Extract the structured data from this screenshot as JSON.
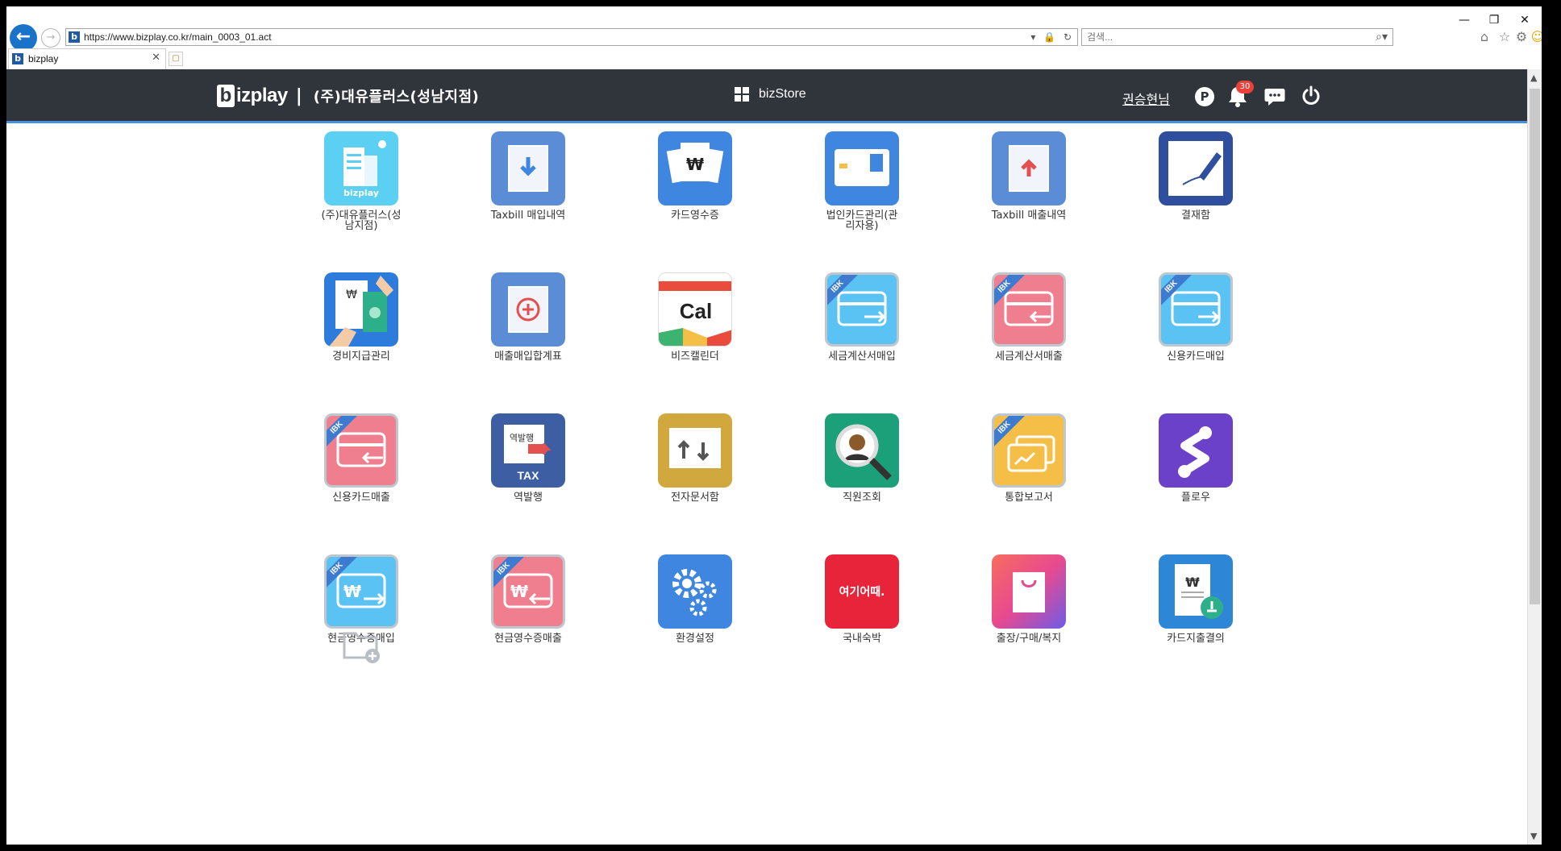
{
  "browser": {
    "url": "https://www.bizplay.co.kr/main_0003_01.act",
    "search_placeholder": "검색...",
    "tab_title": "bizplay",
    "favicon_letter": "b"
  },
  "header": {
    "logo_text": "bizplay",
    "logo_divider": "|",
    "company": "(주)대유플러스(성남지점)",
    "bizstore_label": "bizStore",
    "user_name": "권승현님",
    "point_label": "P",
    "notification_count": "30"
  },
  "apps": [
    {
      "label": "(주)대유플러스(성남지점)",
      "icon": "building-icon",
      "color": "#5bd0f2"
    },
    {
      "label": "Taxbill 매입내역",
      "icon": "taxbill-in-icon",
      "color": "#5b8dd6"
    },
    {
      "label": "카드영수증",
      "icon": "card-receipt-icon",
      "color": "#3f86e0"
    },
    {
      "label": "법인카드관리(관리자용)",
      "icon": "corporate-card-icon",
      "color": "#3f86e0"
    },
    {
      "label": "Taxbill 매출내역",
      "icon": "taxbill-out-icon",
      "color": "#5b8dd6"
    },
    {
      "label": "결재함",
      "icon": "approval-icon",
      "color": "#2f4f9e"
    },
    {
      "label": "경비지급관리",
      "icon": "expense-icon",
      "color": "#2d7cdc"
    },
    {
      "label": "매출매입합계표",
      "icon": "summary-icon",
      "color": "#5b8dd6"
    },
    {
      "label": "비즈캘린더",
      "icon": "calendar-icon",
      "color": "#ffffff"
    },
    {
      "label": "세금계산서매입",
      "icon": "tax-invoice-in-icon",
      "color": "#5ac3f3"
    },
    {
      "label": "세금계산서매출",
      "icon": "tax-invoice-out-icon",
      "color": "#ef7e8e"
    },
    {
      "label": "신용카드매입",
      "icon": "credit-card-in-icon",
      "color": "#5ac3f3"
    },
    {
      "label": "신용카드매출",
      "icon": "credit-card-out-icon",
      "color": "#ef7e8e"
    },
    {
      "label": "역발행",
      "icon": "reverse-issue-icon",
      "color": "#3d5ea3"
    },
    {
      "label": "전자문서함",
      "icon": "edoc-icon",
      "color": "#d1a83d"
    },
    {
      "label": "직원조회",
      "icon": "employee-search-icon",
      "color": "#1ba07a"
    },
    {
      "label": "통합보고서",
      "icon": "report-icon",
      "color": "#f5be46"
    },
    {
      "label": "플로우",
      "icon": "flow-icon",
      "color": "#6a41c8"
    },
    {
      "label": "현금영수증매입",
      "icon": "cash-receipt-in-icon",
      "color": "#5ac3f3"
    },
    {
      "label": "현금영수증매출",
      "icon": "cash-receipt-out-icon",
      "color": "#ef7e8e"
    },
    {
      "label": "환경설정",
      "icon": "settings-icon",
      "color": "#3f86e0"
    },
    {
      "label": "국내숙박",
      "icon": "yeogi-icon",
      "color": "#e8243a"
    },
    {
      "label": "출장/구매/복지",
      "icon": "shopping-bag-icon",
      "color": "#e95a8a"
    },
    {
      "label": "카드지출결의",
      "icon": "card-expense-icon",
      "color": "#2e86d6"
    }
  ],
  "icon_text": {
    "bizplay_small": "bizplay",
    "calendar": "Cal",
    "tax": "TAX",
    "reverse": "역발행",
    "yeogi": "여기어때.",
    "ibk": "IBK",
    "won": "₩"
  },
  "add_folder_icon": "folder-add-icon"
}
